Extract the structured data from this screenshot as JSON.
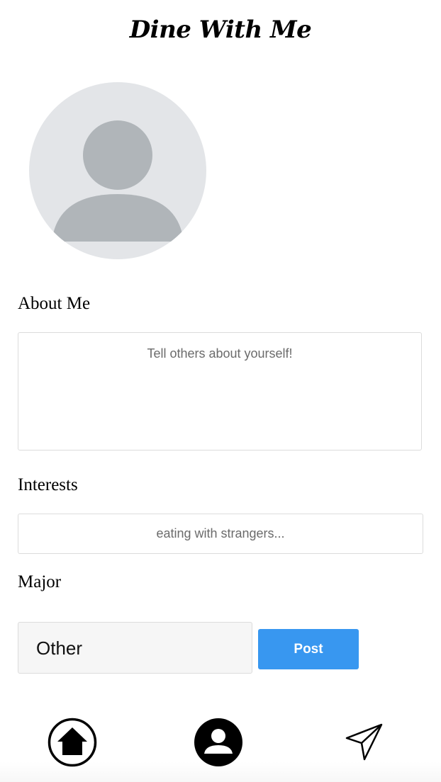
{
  "app": {
    "title": "Dine With Me"
  },
  "profile": {
    "avatar_icon": "default-user-avatar",
    "avatar_colors": {
      "background": "#e3e5e8",
      "figure": "#b0b5b9"
    }
  },
  "about": {
    "label": "About Me",
    "placeholder": "Tell others about yourself!",
    "value": ""
  },
  "interests": {
    "label": "Interests",
    "placeholder": "eating with strangers...",
    "value": ""
  },
  "major": {
    "label": "Major",
    "selected": "Other"
  },
  "post_button": {
    "label": "Post",
    "color": "#3897f0"
  },
  "bottom_nav": {
    "items": [
      {
        "icon": "home-icon"
      },
      {
        "icon": "profile-icon"
      },
      {
        "icon": "send-icon"
      }
    ]
  }
}
